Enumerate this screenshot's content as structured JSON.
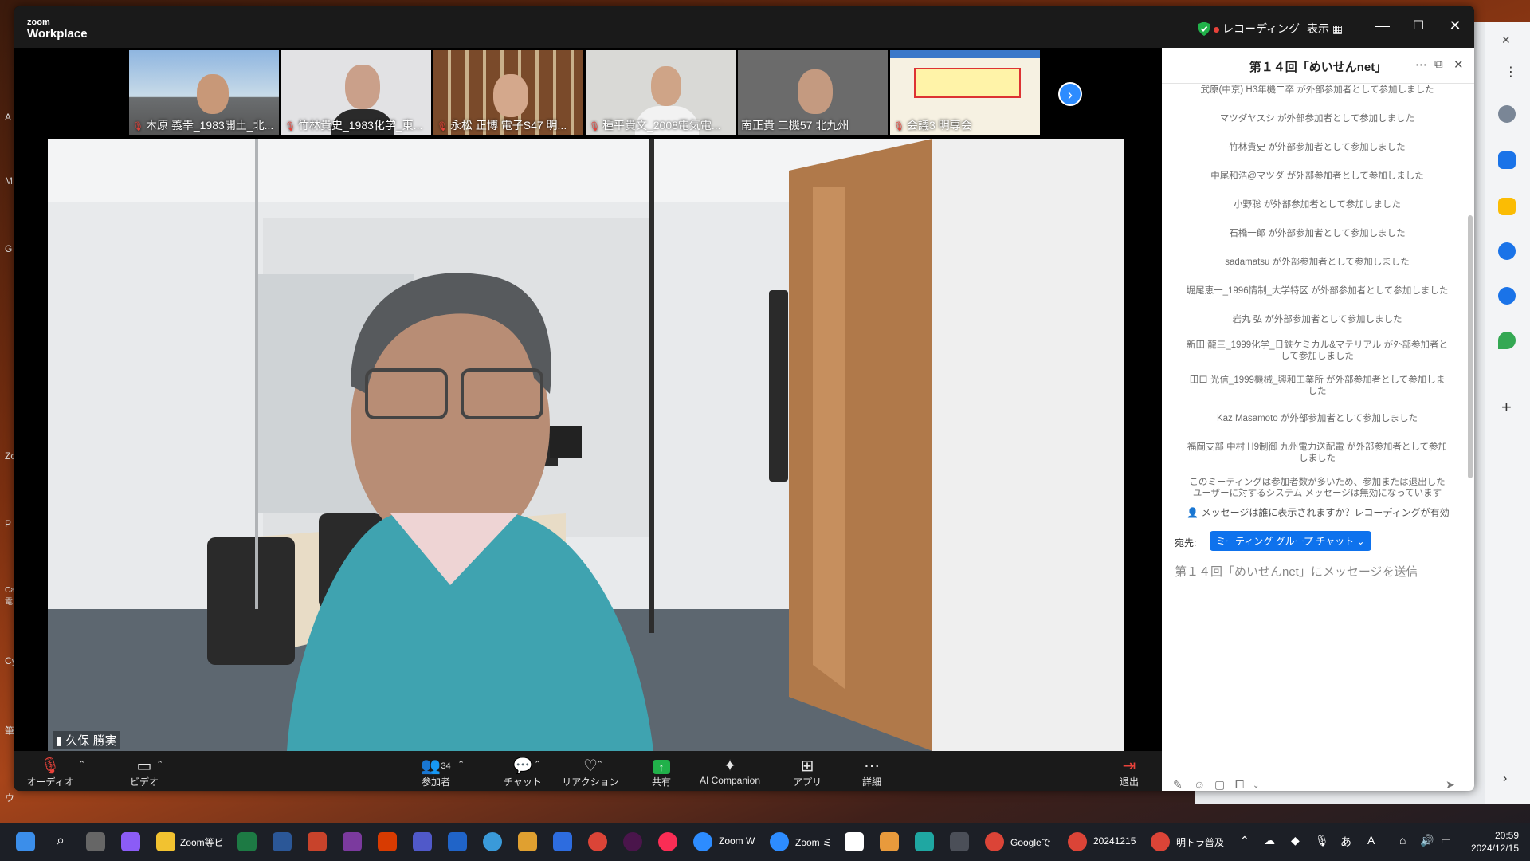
{
  "desktop": {
    "left_labels": [
      "A",
      "M",
      "G",
      "Zo",
      "P",
      "Ca 電",
      "Cy",
      "筆",
      "ウ"
    ]
  },
  "zoom": {
    "logo_top": "zoom",
    "logo_bottom": "Workplace",
    "recording": "レコーディング",
    "view": "表示",
    "thumbnails": [
      {
        "name": "木原 義幸_1983開土_北..."
      },
      {
        "name": "竹林貴史_1983化学_東..."
      },
      {
        "name": "永松 正博 電子S47 明..."
      },
      {
        "name": "種平貴文_2008電気電..."
      },
      {
        "name": "南正貴 二機57 北九州"
      },
      {
        "name": "会議3 明専会"
      }
    ],
    "speaker": "久保 勝実",
    "toolbar": {
      "audio": "オーディオ",
      "video": "ビデオ",
      "participants": "参加者",
      "participants_count": "34",
      "chat": "チャット",
      "reactions": "リアクション",
      "share": "共有",
      "ai": "AI Companion",
      "apps": "アプリ",
      "more": "詳細",
      "leave": "退出"
    },
    "chat": {
      "title": "第１４回「めいせんnet」",
      "messages": [
        "武原(中京) H3年機二卒 が外部参加者として参加しました",
        "マツダヤスシ が外部参加者として参加しました",
        "竹林貴史 が外部参加者として参加しました",
        "中尾和浩@マツダ が外部参加者として参加しました",
        "小野聡 が外部参加者として参加しました",
        "石橋一郎 が外部参加者として参加しました",
        "sadamatsu が外部参加者として参加しました",
        "堀尾恵一_1996情制_大学特区 が外部参加者として参加しました",
        "岩丸 弘 が外部参加者として参加しました",
        "新田 龍三_1999化学_日鉄ケミカル&マテリアル が外部参加者として参加しました",
        "田口 光信_1999機械_興和工業所 が外部参加者として参加しました",
        "Kaz Masamoto が外部参加者として参加しました",
        "福岡支部 中村 H9制御 九州電力送配電 が外部参加者として参加しました",
        "このミーティングは参加者数が多いため、参加または退出したユーザーに対するシステム メッセージは無効になっています"
      ],
      "notice": "メッセージは誰に表示されますか？レコーディングが有効",
      "to_label": "宛先:",
      "to_value": "ミーティング グループ チャット ⌄",
      "placeholder": "第１４回「めいせんnet」にメッセージを送信"
    }
  },
  "taskbar": {
    "apps": [
      "Zoom等ビ",
      "Zoom W",
      "Zoom ミ",
      "Googleで",
      "20241215",
      "明トラ普及"
    ],
    "ime": "あ",
    "time": "20:59",
    "date": "2024/12/15"
  }
}
